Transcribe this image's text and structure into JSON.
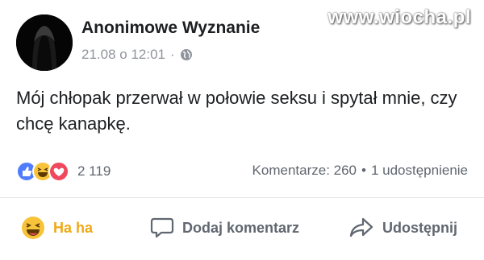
{
  "watermark": "www.wiocha.pl",
  "post": {
    "author": "Anonimowe Wyznanie",
    "timestamp": "21.08 o 12:01",
    "separator": "·",
    "text": "Mój chłopak przerwał w połowie seksu i spytał mnie, czy chcę kanapkę."
  },
  "reactions": {
    "icons": [
      "like-icon",
      "haha-icon",
      "love-icon"
    ],
    "count": "2 119"
  },
  "stats": {
    "comments": "Komentarze: 260",
    "separator": "•",
    "shares": "1 udostępnienie"
  },
  "actions": {
    "react_label": "Ha ha",
    "comment_label": "Dodaj komentarz",
    "share_label": "Udostępnij"
  },
  "colors": {
    "haha_accent": "#f0a814",
    "like": "#4f7cff",
    "love": "#f0495d",
    "meta_text": "#90949c"
  }
}
